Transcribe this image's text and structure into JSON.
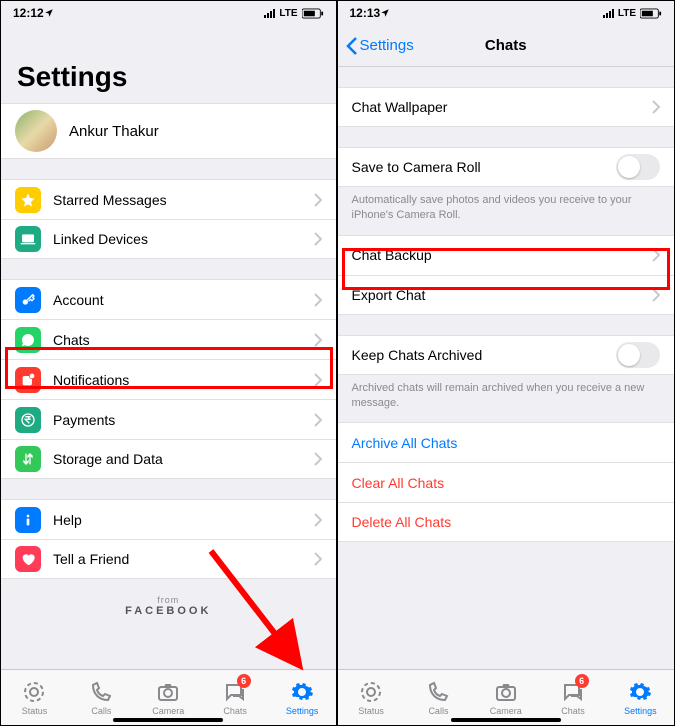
{
  "left": {
    "time": "12:12",
    "signal_label": "LTE",
    "title": "Settings",
    "profile_name": "Ankur Thakur",
    "group1": [
      {
        "label": "Starred Messages",
        "name": "starred-messages",
        "icon_bg": "#ffcc00"
      },
      {
        "label": "Linked Devices",
        "name": "linked-devices",
        "icon_bg": "#1eaa82"
      }
    ],
    "group2": [
      {
        "label": "Account",
        "name": "account",
        "icon_bg": "#007aff"
      },
      {
        "label": "Chats",
        "name": "chats",
        "icon_bg": "#25d366"
      },
      {
        "label": "Notifications",
        "name": "notifications",
        "icon_bg": "#ff3b30"
      },
      {
        "label": "Payments",
        "name": "payments",
        "icon_bg": "#1eaa82"
      },
      {
        "label": "Storage and Data",
        "name": "storage-data",
        "icon_bg": "#34c759"
      }
    ],
    "group3": [
      {
        "label": "Help",
        "name": "help",
        "icon_bg": "#007aff"
      },
      {
        "label": "Tell a Friend",
        "name": "tell-friend",
        "icon_bg": "#ff3b57"
      }
    ],
    "from_label": "from",
    "facebook_label": "FACEBOOK",
    "tabs": {
      "status": "Status",
      "calls": "Calls",
      "camera": "Camera",
      "chats": "Chats",
      "settings": "Settings",
      "chats_badge": "6"
    }
  },
  "right": {
    "time": "12:13",
    "signal_label": "LTE",
    "back_label": "Settings",
    "title": "Chats",
    "wallpaper_label": "Chat Wallpaper",
    "save_camera_label": "Save to Camera Roll",
    "save_camera_note": "Automatically save photos and videos you receive to your iPhone's Camera Roll.",
    "backup_label": "Chat Backup",
    "export_label": "Export Chat",
    "keep_archived_label": "Keep Chats Archived",
    "keep_archived_note": "Archived chats will remain archived when you receive a new message.",
    "archive_all": "Archive All Chats",
    "clear_all": "Clear All Chats",
    "delete_all": "Delete All Chats",
    "tabs": {
      "status": "Status",
      "calls": "Calls",
      "camera": "Camera",
      "chats": "Chats",
      "settings": "Settings",
      "chats_badge": "6"
    }
  }
}
